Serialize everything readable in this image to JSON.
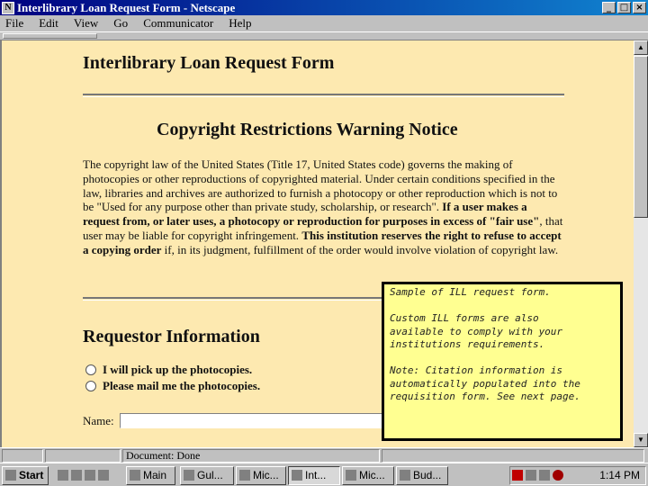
{
  "window": {
    "title": "Interlibrary Loan Request Form - Netscape"
  },
  "menu": [
    "File",
    "Edit",
    "View",
    "Go",
    "Communicator",
    "Help"
  ],
  "page": {
    "heading": "Interlibrary Loan Request Form",
    "notice_title": "Copyright Restrictions Warning Notice",
    "notice": {
      "part1": "The copyright law of the United States (Title 17, United States code) governs the making of photocopies or other reproductions of copyrighted material. Under certain conditions specified in the law, libraries and archives are authorized to furnish a photocopy or other reproduction which is not to be \"Used for any purpose other than private study, scholarship, or research\". ",
      "part2": "If a user makes a request from, or later uses, a photocopy or reproduction for purposes in excess of \"fair use\"",
      "part3": ", that user may be liable for copyright infringement. ",
      "part4": "This institution reserves the right to refuse to accept a copying order",
      "part5": " if, in its judgment, fulfillment of the order would involve violation of copyright law."
    },
    "requestor_title": "Requestor Information",
    "options": [
      "I will pick up the photocopies.",
      "Please mail me the photocopies."
    ],
    "name_label": "Name:"
  },
  "note": {
    "line1": "Sample of ILL request form.",
    "line2": "Custom ILL forms are also\navailable to comply with your\ninstitutions requirements.",
    "line3": "Note:  Citation information is\nautomatically populated into the\nrequisition form.  See next page."
  },
  "status": {
    "text": "Document: Done"
  },
  "taskbar": {
    "start": "Start",
    "items": [
      "Main",
      "Gul...",
      "Mic...",
      "Int...",
      "Mic...",
      "Bud..."
    ],
    "clock": "1:14 PM"
  }
}
